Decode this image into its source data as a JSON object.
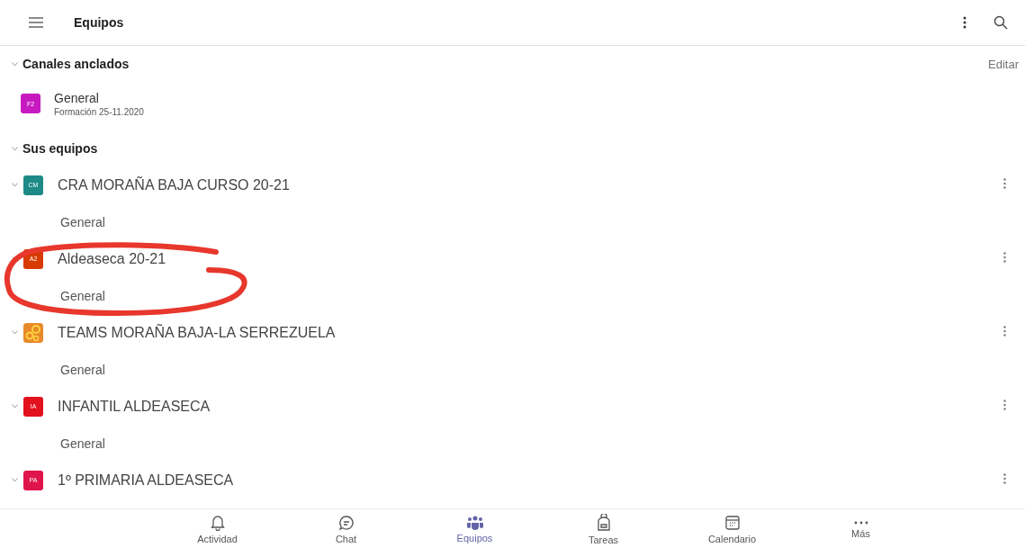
{
  "header": {
    "title": "Equipos"
  },
  "pinned": {
    "title": "Canales anclados",
    "expanded": true,
    "action": "Editar",
    "channels": [
      {
        "initials": "F2",
        "color": "#c719c0",
        "name": "General",
        "team": "Formación 25-11.2020"
      }
    ]
  },
  "teams_section": {
    "title": "Sus equipos",
    "expanded": true,
    "teams": [
      {
        "kind": "initials",
        "initials": "CM",
        "color": "#1d8a87",
        "name": "CRA MORAÑA BAJA CURSO 20-21",
        "expanded": true,
        "channels": [
          "General"
        ]
      },
      {
        "kind": "initials",
        "initials": "A2",
        "color": "#d83b01",
        "name": "Aldeaseca 20-21",
        "expanded": true,
        "channels": [
          "General"
        ]
      },
      {
        "kind": "gears",
        "color": "#e8892b",
        "name": "TEAMS MORAÑA BAJA-LA SERREZUELA",
        "expanded": true,
        "channels": [
          "General"
        ]
      },
      {
        "kind": "initials",
        "initials": "IA",
        "color": "#e3101e",
        "name": "INFANTIL ALDEASECA",
        "expanded": true,
        "channels": [
          "General"
        ]
      },
      {
        "kind": "initials",
        "initials": "PA",
        "color": "#e0144c",
        "name": "1º PRIMARIA ALDEASECA",
        "expanded": true
      }
    ]
  },
  "nav": [
    {
      "label": "Actividad",
      "selected": false
    },
    {
      "label": "Chat",
      "selected": false
    },
    {
      "label": "Equipos",
      "selected": true
    },
    {
      "label": "Tareas",
      "selected": false
    },
    {
      "label": "Calendario",
      "selected": false
    },
    {
      "label": "Más",
      "selected": false
    }
  ]
}
